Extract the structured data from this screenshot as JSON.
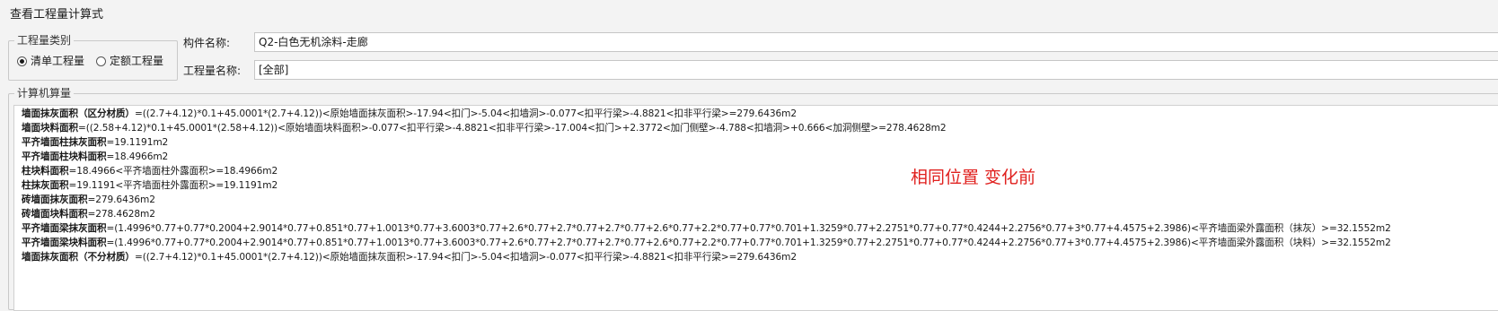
{
  "window": {
    "title": "查看工程量计算式"
  },
  "quantity_type": {
    "legend": "工程量类别",
    "options": [
      {
        "label": "清单工程量",
        "selected": true
      },
      {
        "label": "定额工程量",
        "selected": false
      }
    ]
  },
  "component": {
    "label": "构件名称:",
    "value": "Q2-白色无机涂料-走廊"
  },
  "quantity_name": {
    "label": "工程量名称:",
    "value": "[全部]"
  },
  "calc": {
    "legend": "计算机算量",
    "lines": [
      {
        "label": "墙面抹灰面积（区分材质）",
        "expr": "=((2.7+4.12)*0.1+45.0001*(2.7+4.12))<原始墙面抹灰面积>-17.94<扣门>-5.04<扣墙洞>-0.077<扣平行梁>-4.8821<扣非平行梁>=279.6436m2"
      },
      {
        "label": "墙面块料面积",
        "expr": "=((2.58+4.12)*0.1+45.0001*(2.58+4.12))<原始墙面块料面积>-0.077<扣平行梁>-4.8821<扣非平行梁>-17.004<扣门>+2.3772<加门侧壁>-4.788<扣墙洞>+0.666<加洞侧壁>=278.4628m2"
      },
      {
        "label": "平齐墙面柱抹灰面积",
        "expr": "=19.1191m2"
      },
      {
        "label": "平齐墙面柱块料面积",
        "expr": "=18.4966m2"
      },
      {
        "label": "柱块料面积",
        "expr": "=18.4966<平齐墙面柱外露面积>=18.4966m2"
      },
      {
        "label": "柱抹灰面积",
        "expr": "=19.1191<平齐墙面柱外露面积>=19.1191m2"
      },
      {
        "label": "砖墙面抹灰面积",
        "expr": "=279.6436m2"
      },
      {
        "label": "砖墙面块料面积",
        "expr": "=278.4628m2"
      },
      {
        "label": "平齐墙面梁抹灰面积",
        "expr": "=(1.4996*0.77+0.77*0.2004+2.9014*0.77+0.851*0.77+1.0013*0.77+3.6003*0.77+2.6*0.77+2.7*0.77+2.7*0.77+2.6*0.77+2.2*0.77+0.77*0.701+1.3259*0.77+2.2751*0.77+0.77*0.4244+2.2756*0.77+3*0.77+4.4575+2.3986)<平齐墙面梁外露面积（抹灰）>=32.1552m2"
      },
      {
        "label": "平齐墙面梁块料面积",
        "expr": "=(1.4996*0.77+0.77*0.2004+2.9014*0.77+0.851*0.77+1.0013*0.77+3.6003*0.77+2.6*0.77+2.7*0.77+2.7*0.77+2.6*0.77+2.2*0.77+0.77*0.701+1.3259*0.77+2.2751*0.77+0.77*0.4244+2.2756*0.77+3*0.77+4.4575+2.3986)<平齐墙面梁外露面积（块料）>=32.1552m2"
      },
      {
        "label": "墙面抹灰面积（不分材质）",
        "expr": "=((2.7+4.12)*0.1+45.0001*(2.7+4.12))<原始墙面抹灰面积>-17.94<扣门>-5.04<扣墙洞>-0.077<扣平行梁>-4.8821<扣非平行梁>=279.6436m2"
      }
    ]
  },
  "annotation": {
    "text": "相同位置 变化前",
    "color": "#e0201e"
  }
}
